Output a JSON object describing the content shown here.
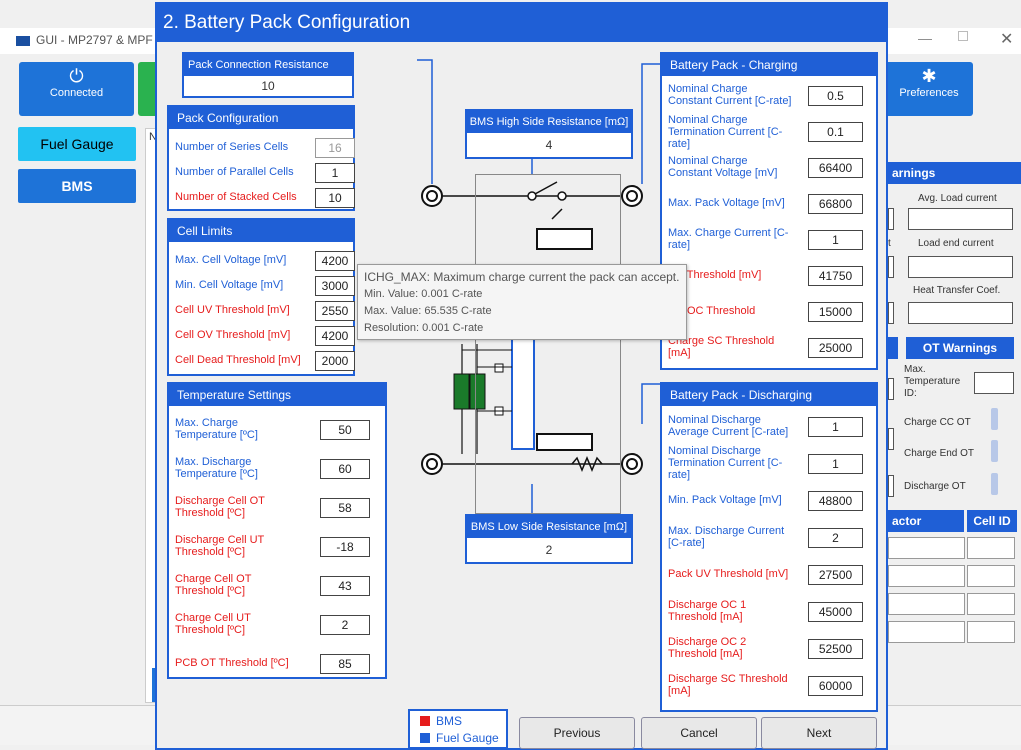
{
  "background": {
    "app_title": "GUI - MP2797 & MPF",
    "window_controls": {
      "minimize": "—",
      "close": "✕"
    },
    "toolbar": {
      "connected_label": "Connected",
      "preferences_label": "Preferences"
    },
    "sidebar": {
      "fuel_gauge": "Fuel Gauge",
      "bms": "BMS"
    },
    "panel_tab_letter": "N",
    "right_panel": {
      "warnings_header": "arnings",
      "avg_load_current": "Avg. Load current",
      "load_end_current": "Load end current",
      "heat_transfer": "Heat Transfer Coef.",
      "ot_warnings_header": "OT Warnings",
      "max_temp_id": "Max.\nTemperature\nID:",
      "charge_cc_ot": "Charge CC OT",
      "charge_end_ot": "Charge End OT",
      "discharge_ot": "Discharge OT",
      "factor_header": "actor",
      "cell_id_header": "Cell ID",
      "stray_t": "t"
    }
  },
  "dialog": {
    "title": "2. Battery Pack Configuration",
    "pack_connection_resistance": {
      "label": "Pack Connection Resistance [mΩ]",
      "value": "10"
    },
    "bms_high_side_resistance": {
      "label": "BMS High Side Resistance [mΩ]",
      "value": "4"
    },
    "bms_low_side_resistance": {
      "label": "BMS Low Side Resistance [mΩ]",
      "value": "2"
    },
    "pack_configuration": {
      "title": "Pack Configuration",
      "rows": [
        {
          "label": "Number of Series Cells",
          "value": "16",
          "color": "blue",
          "disabled": true
        },
        {
          "label": "Number of Parallel Cells",
          "value": "1",
          "color": "blue"
        },
        {
          "label": "Number of Stacked Cells",
          "value": "10",
          "color": "red"
        }
      ]
    },
    "cell_limits": {
      "title": "Cell Limits",
      "rows": [
        {
          "label": "Max. Cell Voltage [mV]",
          "value": "4200",
          "color": "blue"
        },
        {
          "label": "Min. Cell Voltage [mV]",
          "value": "3000",
          "color": "blue"
        },
        {
          "label": "Cell UV Threshold [mV]",
          "value": "2550",
          "color": "red"
        },
        {
          "label": "Cell OV Threshold [mV]",
          "value": "4200",
          "color": "red"
        },
        {
          "label": "Cell Dead Threshold [mV]",
          "value": "2000",
          "color": "red"
        }
      ]
    },
    "temperature_settings": {
      "title": "Temperature Settings",
      "rows": [
        {
          "label": "Max. Charge\nTemperature [ºC]",
          "value": "50",
          "color": "blue"
        },
        {
          "label": "Max. Discharge\nTemperature [ºC]",
          "value": "60",
          "color": "blue"
        },
        {
          "label": "Discharge Cell OT\nThreshold [ºC]",
          "value": "58",
          "color": "red"
        },
        {
          "label": "Discharge Cell UT\nThreshold [ºC]",
          "value": "-18",
          "color": "red"
        },
        {
          "label": "Charge Cell OT\nThreshold [ºC]",
          "value": "43",
          "color": "red"
        },
        {
          "label": "Charge Cell UT\nThreshold [ºC]",
          "value": "2",
          "color": "red"
        },
        {
          "label": "PCB OT Threshold [ºC]",
          "value": "85",
          "color": "red"
        }
      ]
    },
    "charging": {
      "title": "Battery Pack - Charging",
      "rows": [
        {
          "label": "Nominal Charge\nConstant Current [C-rate]",
          "value": "0.5",
          "color": "blue"
        },
        {
          "label": "Nominal Charge\nTermination Current [C-\nrate]",
          "value": "0.1",
          "color": "blue"
        },
        {
          "label": "Nominal Charge\nConstant Voltage [mV]",
          "value": "66400",
          "color": "blue"
        },
        {
          "label": "Max. Pack Voltage [mV]",
          "value": "66800",
          "color": "blue"
        },
        {
          "label": "Max. Charge Current [C-\nrate]",
          "value": "1",
          "color": "blue"
        },
        {
          "label": "OV Threshold [mV]",
          "value": "41750",
          "color": "red"
        },
        {
          "label": "rge OC Threshold",
          "value": "15000",
          "color": "red"
        },
        {
          "label": "Charge SC Threshold\n[mA]",
          "value": "25000",
          "color": "red"
        }
      ]
    },
    "discharging": {
      "title": "Battery Pack - Discharging",
      "rows": [
        {
          "label": "Nominal Discharge\nAverage Current [C-rate]",
          "value": "1",
          "color": "blue"
        },
        {
          "label": "Nominal Discharge\nTermination Current [C-\nrate]",
          "value": "1",
          "color": "blue"
        },
        {
          "label": "Min. Pack Voltage [mV]",
          "value": "48800",
          "color": "blue"
        },
        {
          "label": "Max. Discharge Current\n[C-rate]",
          "value": "2",
          "color": "blue"
        },
        {
          "label": "Pack UV Threshold [mV]",
          "value": "27500",
          "color": "red"
        },
        {
          "label": "Discharge OC 1\nThreshold [mA]",
          "value": "45000",
          "color": "red"
        },
        {
          "label": "Discharge OC 2\nThreshold [mA]",
          "value": "52500",
          "color": "red"
        },
        {
          "label": "Discharge SC Threshold\n[mA]",
          "value": "60000",
          "color": "red"
        }
      ]
    },
    "tooltip": {
      "line1": "ICHG_MAX: Maximum charge current the pack can accept.",
      "line2": "Min. Value: 0.001 C-rate",
      "line3": "Max. Value: 65.535 C-rate",
      "line4": "Resolution: 0.001 C-rate"
    },
    "legend": {
      "bms": "BMS",
      "fuel_gauge": "Fuel Gauge",
      "bms_color": "#e61c1c",
      "fuel_gauge_color": "#1f5fd6"
    },
    "buttons": {
      "previous": "Previous",
      "cancel": "Cancel",
      "next": "Next"
    }
  }
}
